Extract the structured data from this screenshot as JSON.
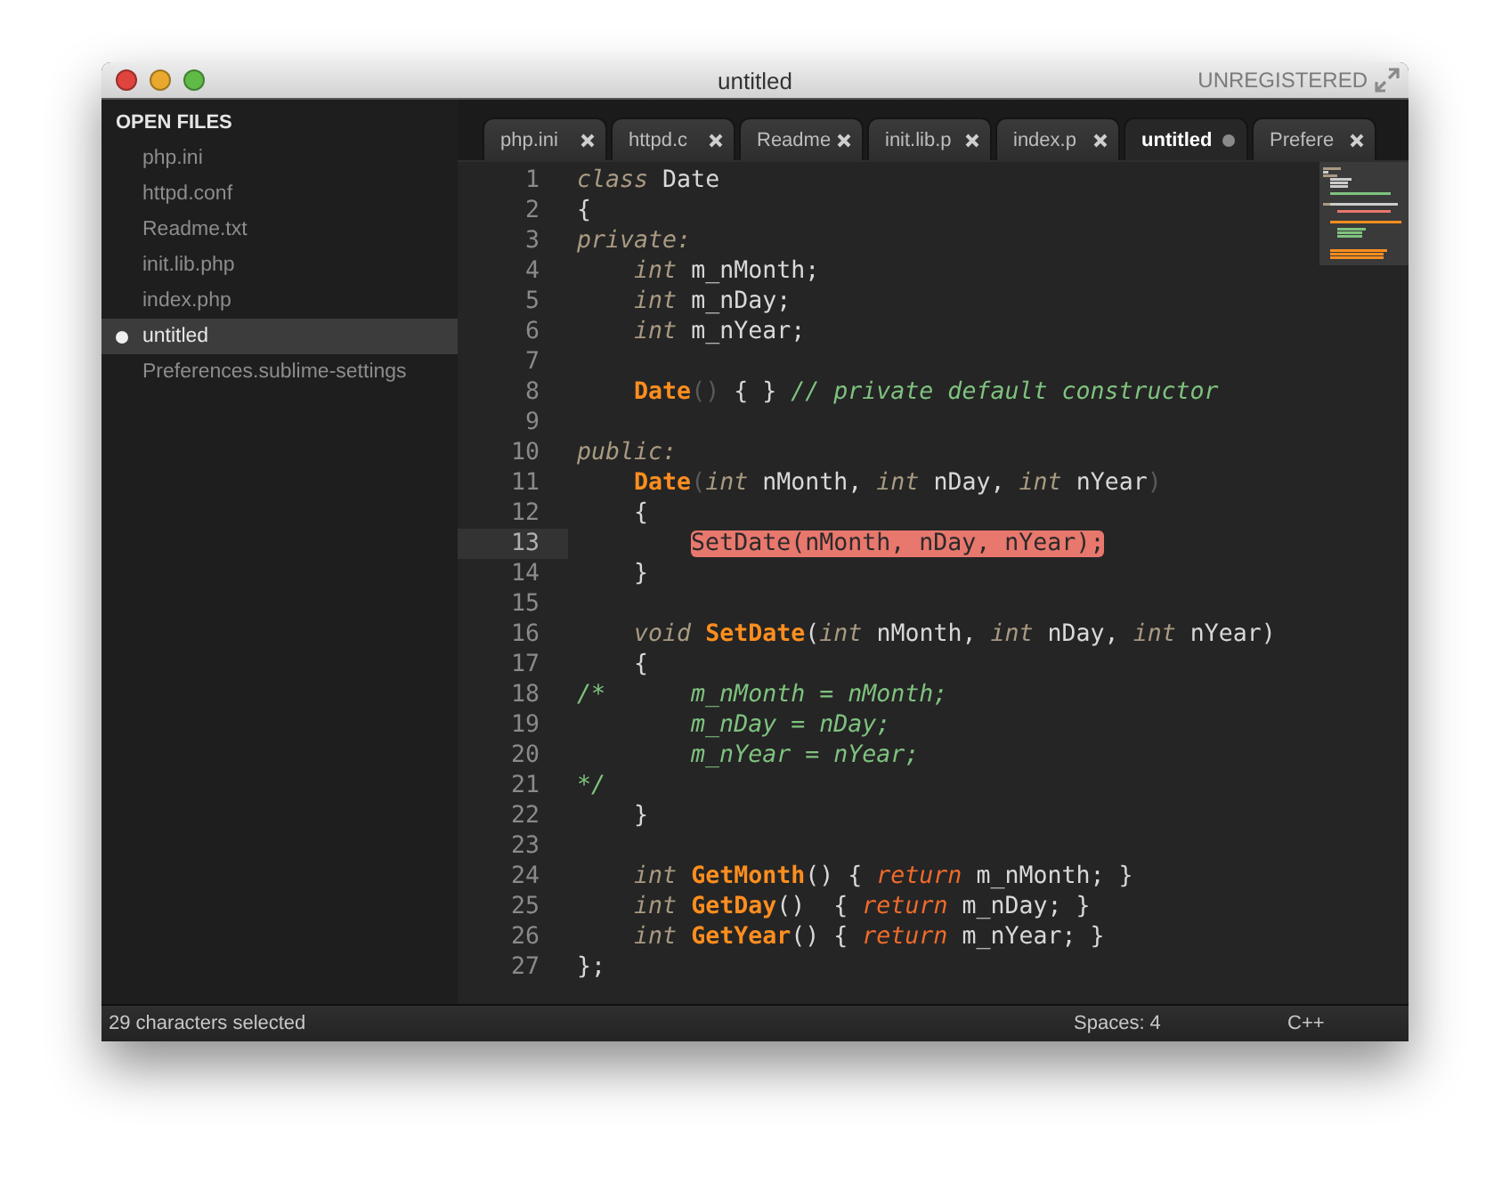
{
  "window": {
    "title": "untitled",
    "badge": "UNREGISTERED"
  },
  "sidebar": {
    "heading": "OPEN FILES",
    "items": [
      {
        "label": "php.ini",
        "selected": false,
        "dirty": false
      },
      {
        "label": "httpd.conf",
        "selected": false,
        "dirty": false
      },
      {
        "label": "Readme.txt",
        "selected": false,
        "dirty": false
      },
      {
        "label": "init.lib.php",
        "selected": false,
        "dirty": false
      },
      {
        "label": "index.php",
        "selected": false,
        "dirty": false
      },
      {
        "label": "untitled",
        "selected": true,
        "dirty": true
      },
      {
        "label": "Preferences.sublime-settings",
        "selected": false,
        "dirty": false
      }
    ]
  },
  "tabs": [
    {
      "label": "php.ini",
      "selected": false,
      "dirty": false
    },
    {
      "label": "httpd.c",
      "selected": false,
      "dirty": false
    },
    {
      "label": "Readme",
      "selected": false,
      "dirty": false
    },
    {
      "label": "init.lib.p",
      "selected": false,
      "dirty": false
    },
    {
      "label": "index.p",
      "selected": false,
      "dirty": false
    },
    {
      "label": "untitled",
      "selected": true,
      "dirty": true
    },
    {
      "label": "Prefere",
      "selected": false,
      "dirty": false
    }
  ],
  "editor": {
    "lines": [
      {
        "n": "1",
        "current": false,
        "tokens": [
          {
            "t": "class",
            "kind": "kw"
          },
          {
            "t": " Date",
            "kind": "plain"
          }
        ]
      },
      {
        "n": "2",
        "current": false,
        "tokens": [
          {
            "t": "{",
            "kind": "plain"
          }
        ]
      },
      {
        "n": "3",
        "current": false,
        "tokens": [
          {
            "t": "private:",
            "kind": "kw"
          }
        ]
      },
      {
        "n": "4",
        "current": false,
        "tokens": [
          {
            "t": "    int",
            "kind": "kw"
          },
          {
            "t": " m_nMonth;",
            "kind": "plain"
          }
        ]
      },
      {
        "n": "5",
        "current": false,
        "tokens": [
          {
            "t": "    int",
            "kind": "kw"
          },
          {
            "t": " m_nDay;",
            "kind": "plain"
          }
        ]
      },
      {
        "n": "6",
        "current": false,
        "tokens": [
          {
            "t": "    int",
            "kind": "kw"
          },
          {
            "t": " m_nYear;",
            "kind": "plain"
          }
        ]
      },
      {
        "n": "7",
        "current": false
      },
      {
        "n": "8",
        "current": false,
        "tokens": [
          {
            "t": "    Date",
            "kind": "fn"
          },
          {
            "t": "()",
            "kind": "paren"
          },
          {
            "t": " { } ",
            "kind": "plain"
          },
          {
            "t": "// private default constructor",
            "kind": "cm"
          }
        ]
      },
      {
        "n": "9",
        "current": false
      },
      {
        "n": "10",
        "current": false,
        "tokens": [
          {
            "t": "public:",
            "kind": "kw"
          }
        ]
      },
      {
        "n": "11",
        "current": false,
        "tokens": [
          {
            "t": "    Date",
            "kind": "fn"
          },
          {
            "t": "(",
            "kind": "paren"
          },
          {
            "t": "int",
            "kind": "kw"
          },
          {
            "t": " nMonth, ",
            "kind": "plain"
          },
          {
            "t": "int",
            "kind": "kw"
          },
          {
            "t": " nDay, ",
            "kind": "plain"
          },
          {
            "t": "int",
            "kind": "kw"
          },
          {
            "t": " nYear",
            "kind": "plain"
          },
          {
            "t": ")",
            "kind": "paren"
          }
        ]
      },
      {
        "n": "12",
        "current": false,
        "tokens": [
          {
            "t": "    {",
            "kind": "plain"
          }
        ]
      },
      {
        "n": "13",
        "current": true,
        "tokens": [
          {
            "t": "        SetDate(nMonth, nDay, nYear);",
            "kind": "sel"
          }
        ]
      },
      {
        "n": "14",
        "current": false,
        "tokens": [
          {
            "t": "    }",
            "kind": "plain"
          }
        ]
      },
      {
        "n": "15",
        "current": false
      },
      {
        "n": "16",
        "current": false,
        "tokens": [
          {
            "t": "    void",
            "kind": "kw"
          },
          {
            "t": " SetDate",
            "kind": "fn"
          },
          {
            "t": "(",
            "kind": "plain"
          },
          {
            "t": "int",
            "kind": "kw"
          },
          {
            "t": " nMonth, ",
            "kind": "plain"
          },
          {
            "t": "int",
            "kind": "kw"
          },
          {
            "t": " nDay, ",
            "kind": "plain"
          },
          {
            "t": "int",
            "kind": "kw"
          },
          {
            "t": " nYear)",
            "kind": "plain"
          }
        ]
      },
      {
        "n": "17",
        "current": false,
        "tokens": [
          {
            "t": "    {",
            "kind": "plain"
          }
        ]
      },
      {
        "n": "18",
        "current": false,
        "tokens": [
          {
            "t": "/*      m_nMonth = nMonth;",
            "kind": "cm"
          }
        ]
      },
      {
        "n": "19",
        "current": false,
        "tokens": [
          {
            "t": "        m_nDay = nDay;",
            "kind": "cm"
          }
        ]
      },
      {
        "n": "20",
        "current": false,
        "tokens": [
          {
            "t": "        m_nYear = nYear;",
            "kind": "cm"
          }
        ]
      },
      {
        "n": "21",
        "current": false,
        "tokens": [
          {
            "t": "*/",
            "kind": "cm"
          }
        ]
      },
      {
        "n": "22",
        "current": false,
        "tokens": [
          {
            "t": "    }",
            "kind": "plain"
          }
        ]
      },
      {
        "n": "23",
        "current": false
      },
      {
        "n": "24",
        "current": false,
        "tokens": [
          {
            "t": "    int",
            "kind": "kw"
          },
          {
            "t": " GetMonth",
            "kind": "fn"
          },
          {
            "t": "() { ",
            "kind": "plain"
          },
          {
            "t": "return",
            "kind": "ret"
          },
          {
            "t": " m_nMonth; }",
            "kind": "plain"
          }
        ]
      },
      {
        "n": "25",
        "current": false,
        "tokens": [
          {
            "t": "    int",
            "kind": "kw"
          },
          {
            "t": " GetDay",
            "kind": "fn"
          },
          {
            "t": "()  { ",
            "kind": "plain"
          },
          {
            "t": "return",
            "kind": "ret"
          },
          {
            "t": " m_nDay; }",
            "kind": "plain"
          }
        ]
      },
      {
        "n": "26",
        "current": false,
        "tokens": [
          {
            "t": "    int",
            "kind": "kw"
          },
          {
            "t": " GetYear",
            "kind": "fn"
          },
          {
            "t": "() { ",
            "kind": "plain"
          },
          {
            "t": "return",
            "kind": "ret"
          },
          {
            "t": " m_nYear; }",
            "kind": "plain"
          }
        ]
      },
      {
        "n": "27",
        "current": false,
        "tokens": [
          {
            "t": "};",
            "kind": "plain"
          }
        ]
      }
    ]
  },
  "status_bar": {
    "message": "29 characters selected",
    "indent": "Spaces: 4",
    "syntax": "C++"
  }
}
